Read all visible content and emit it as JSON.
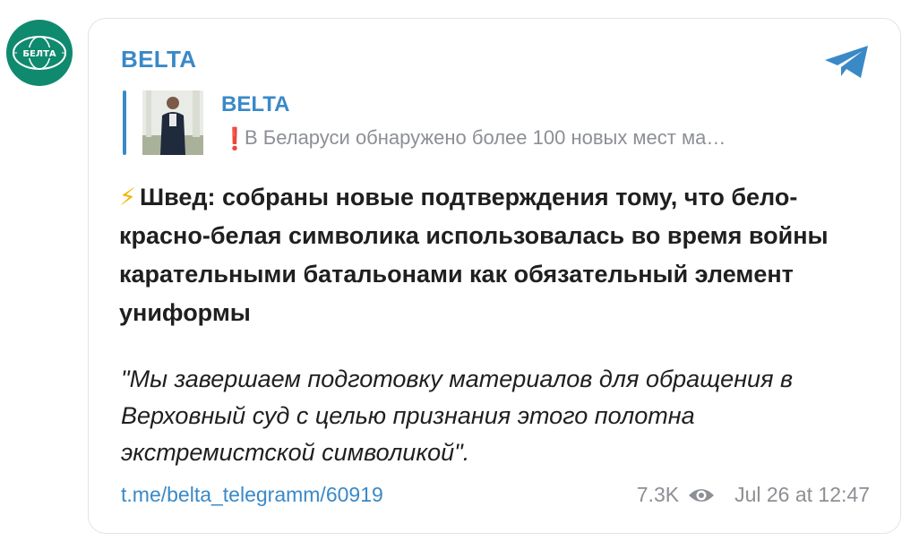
{
  "avatar": {
    "logo_text": "БЕЛТА",
    "color": "#0f8a6e"
  },
  "post": {
    "channel_name": "BELTA",
    "reply": {
      "channel": "BELTA",
      "mark": "❗",
      "text": "В Беларуси обнаружено более 100 новых мест ма…"
    },
    "headline_icon": "⚡",
    "headline": "Швед: собраны новые подтверждения тому, что бело-красно-белая символика использовалась во время войны карательными батальонами как обязательный элемент униформы",
    "quote": "\"Мы завершаем подготовку материалов для обращения в Верховный суд с целью признания этого полотна экстремистской символикой\".",
    "link": "t.me/belta_telegramm/60919",
    "views": "7.3K",
    "timestamp": "Jul 26 at 12:47"
  },
  "colors": {
    "accent": "#3a89c7",
    "muted": "#8c8f94",
    "alert": "#e0262f"
  },
  "icons": [
    "telegram-icon",
    "eye-icon",
    "lightning-icon",
    "exclamation-icon"
  ]
}
